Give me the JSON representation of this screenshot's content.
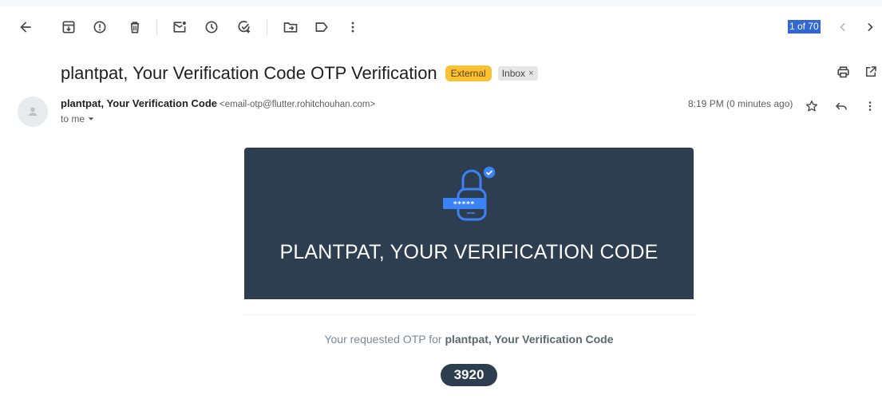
{
  "toolbar": {
    "pager": "1 of 70"
  },
  "email": {
    "subject": "plantpat, Your Verification Code OTP Verification",
    "labels": {
      "external": "External",
      "inbox": "Inbox",
      "inbox_remove": "×"
    },
    "sender_name": "plantpat, Your Verification Code",
    "sender_email": "<email-otp@flutter.rohitchouhan.com>",
    "recipient": "to me",
    "timestamp": "8:19 PM (0 minutes ago)"
  },
  "body": {
    "banner_title": "PLANTPAT, YOUR VERIFICATION CODE",
    "password_mask": "*****",
    "otp_prefix": "Your requested OTP for ",
    "otp_for": "plantpat, Your Verification Code",
    "otp_code": "3920"
  },
  "colors": {
    "banner": "#2c3e50",
    "external_tag": "#f9c234",
    "accent": "#3b82f6"
  }
}
